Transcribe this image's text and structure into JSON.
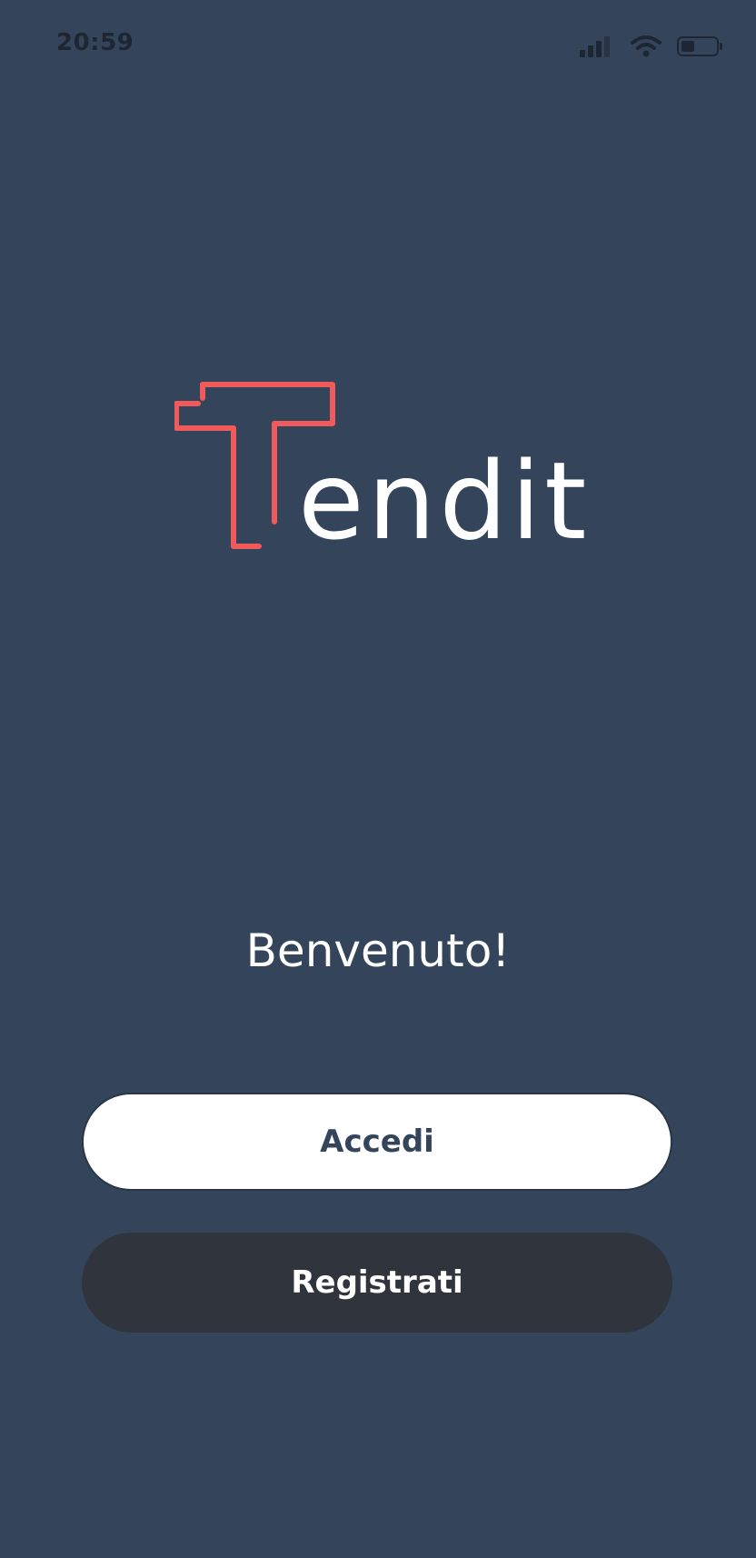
{
  "status_bar": {
    "time": "20:59",
    "icons": [
      "signal-icon",
      "wifi-icon",
      "battery-icon"
    ]
  },
  "logo": {
    "icon": "tendit-t-logo",
    "text": "endit",
    "colors": {
      "mark": "#f05a5a",
      "text": "#ffffff"
    }
  },
  "welcome": {
    "title": "Benvenuto!"
  },
  "actions": {
    "login_label": "Accedi",
    "register_label": "Registrati"
  },
  "colors": {
    "background": "#34445a",
    "login_button": "#ffffff",
    "register_button": "#30353d"
  }
}
